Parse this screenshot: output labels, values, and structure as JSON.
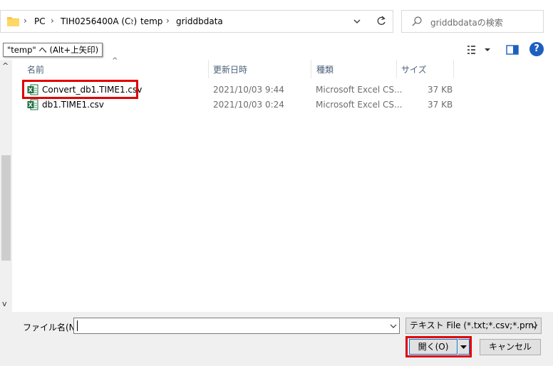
{
  "address_bar": {
    "breadcrumbs": [
      "PC",
      "TIH0256400A (C:)",
      "temp",
      "griddbdata"
    ],
    "separator": "›"
  },
  "search": {
    "placeholder": "griddbdataの検索"
  },
  "tooltip": {
    "text": "\"temp\" へ (Alt+上矢印)"
  },
  "toolbar": {
    "view_dropdown": "▾",
    "help": "?"
  },
  "columns": {
    "name": "名前",
    "date": "更新日時",
    "type": "種類",
    "size": "サイズ"
  },
  "files": [
    {
      "name": "Convert_db1.TIME1.csv",
      "date": "2021/10/03 9:44",
      "type": "Microsoft Excel CS...",
      "size": "37 KB",
      "highlighted": true
    },
    {
      "name": "db1.TIME1.csv",
      "date": "2021/10/03 0:24",
      "type": "Microsoft Excel CS...",
      "size": "37 KB",
      "highlighted": false
    }
  ],
  "bottom": {
    "filename_label": "ファイル名(N):",
    "filename_value": "",
    "file_type": "テキスト File (*.txt;*.csv;*.prn)",
    "open_button": "開く(O)",
    "cancel_button": "キャンセル"
  },
  "colors": {
    "highlight": "#e00000",
    "accent": "#0078d7",
    "excel_green": "#1d7044",
    "folder_yellow": "#f6c744"
  }
}
